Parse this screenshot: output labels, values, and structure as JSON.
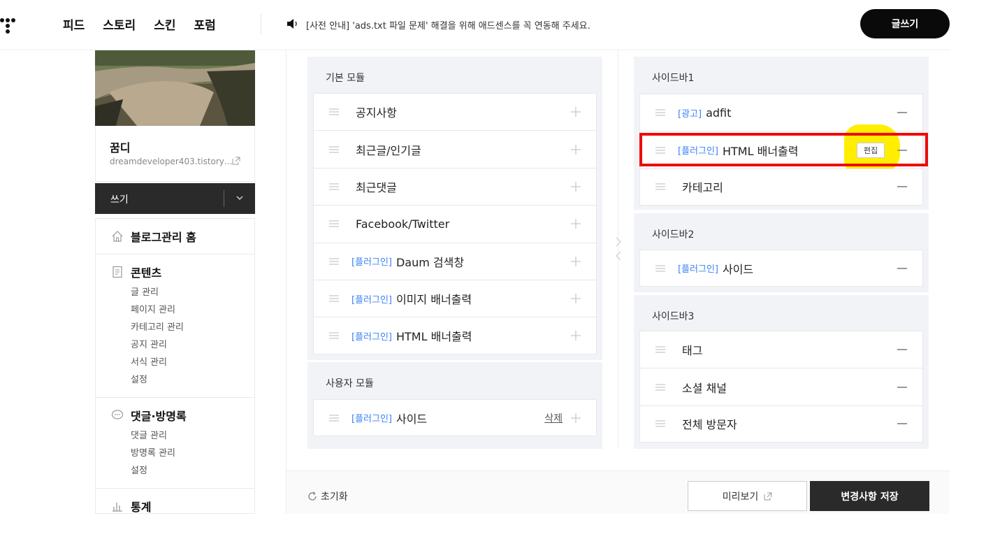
{
  "header": {
    "nav": [
      "피드",
      "스토리",
      "스킨",
      "포럼"
    ],
    "notice": "[사전 안내] 'ads.txt 파일 문제' 해결을 위해 애드센스를 꼭 연동해 주세요.",
    "write_label": "글쓰기"
  },
  "blog": {
    "name": "꿈디",
    "url": "dreamdeveloper403.tistory…"
  },
  "write_bar": {
    "label": "쓰기"
  },
  "menu": {
    "home": "블로그관리 홈",
    "contents": {
      "title": "콘텐츠",
      "items": [
        "글 관리",
        "페이지 관리",
        "카테고리 관리",
        "공지 관리",
        "서식 관리",
        "설정"
      ]
    },
    "comments": {
      "title": "댓글·방명록",
      "items": [
        "댓글 관리",
        "방명록 관리",
        "설정"
      ]
    },
    "stats": "통계"
  },
  "basic_modules": {
    "title": "기본 모듈",
    "items": [
      {
        "tag": "",
        "name": "공지사항"
      },
      {
        "tag": "",
        "name": "최근글/인기글"
      },
      {
        "tag": "",
        "name": "최근댓글"
      },
      {
        "tag": "",
        "name": "Facebook/Twitter"
      },
      {
        "tag": "[플러그인]",
        "name": "Daum 검색창"
      },
      {
        "tag": "[플러그인]",
        "name": "이미지 배너출력"
      },
      {
        "tag": "[플러그인]",
        "name": "HTML 배너출력"
      }
    ]
  },
  "user_modules": {
    "title": "사용자 모듈",
    "items": [
      {
        "tag": "[플러그인]",
        "name": "사이드",
        "delete": "삭제"
      }
    ]
  },
  "sidebar1": {
    "title": "사이드바1",
    "items": [
      {
        "tag": "[광고]",
        "name": "adfit"
      },
      {
        "tag": "[플러그인]",
        "name": "HTML 배너출력",
        "edit": "편집"
      },
      {
        "tag": "",
        "name": "카테고리"
      }
    ]
  },
  "sidebar2": {
    "title": "사이드바2",
    "items": [
      {
        "tag": "[플러그인]",
        "name": "사이드"
      }
    ]
  },
  "sidebar3": {
    "title": "사이드바3",
    "items": [
      {
        "tag": "",
        "name": "태그"
      },
      {
        "tag": "",
        "name": "소셜 채널"
      },
      {
        "tag": "",
        "name": "전체 방문자"
      }
    ]
  },
  "footer": {
    "reset": "초기화",
    "preview": "미리보기",
    "save": "변경사항 저장"
  },
  "colors": {
    "tag_blue": "#3b82f6",
    "highlight_red": "#ee0a0a",
    "highlight_yellow": "#ffee00"
  }
}
